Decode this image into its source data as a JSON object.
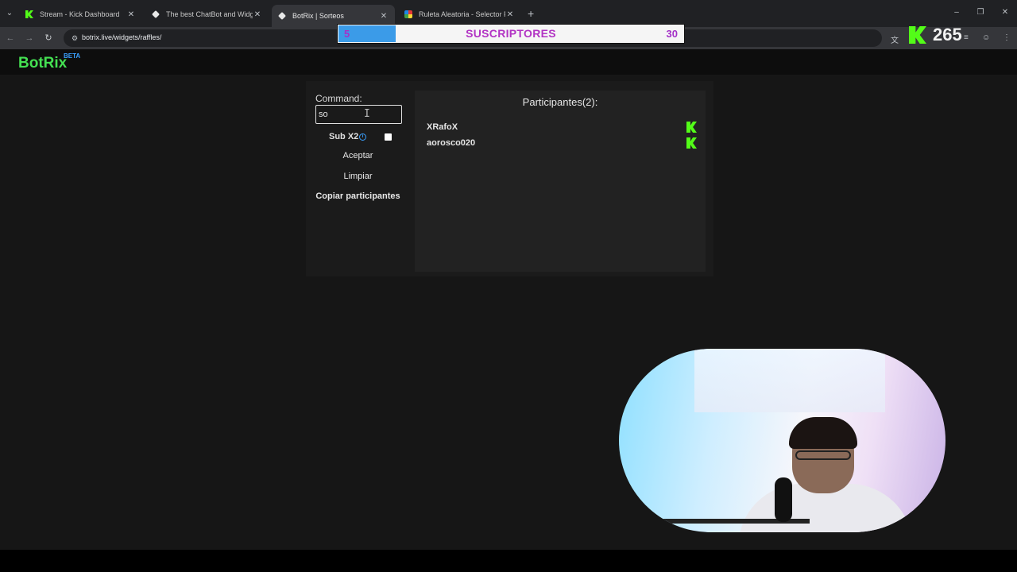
{
  "browser": {
    "tabs": [
      {
        "title": "Stream - Kick Dashboard",
        "icon": "kick-icon",
        "active": false
      },
      {
        "title": "The best ChatBot and Widgets",
        "icon": "botrix-icon",
        "active": false
      },
      {
        "title": "BotRix | Sorteos",
        "icon": "botrix-icon",
        "active": true
      },
      {
        "title": "Ruleta Aleatoria - Selector Pers",
        "icon": "wheel-icon",
        "active": false
      }
    ],
    "new_tab_symbol": "+",
    "url": "botrix.live/widgets/raffles/"
  },
  "stream_overlay": {
    "sub_goal": {
      "current": "5",
      "label": "SUSCRIPTORES",
      "goal": "30",
      "progress": 0.16667
    },
    "viewer_count": "265"
  },
  "site": {
    "brand": "BotRix",
    "beta": "BETA",
    "accent": "#44e052"
  },
  "raffle": {
    "command_label": "Command:",
    "command_value": "so",
    "subx2_label": "Sub X2",
    "accept_label": "Aceptar",
    "clear_label": "Limpiar",
    "copy_label": "Copiar participantes",
    "participants_title": "Participantes(2):",
    "participants": [
      {
        "name": "XRafoX",
        "platform": "kick-icon"
      },
      {
        "name": "aorosco020",
        "platform": "kick-icon"
      }
    ]
  }
}
